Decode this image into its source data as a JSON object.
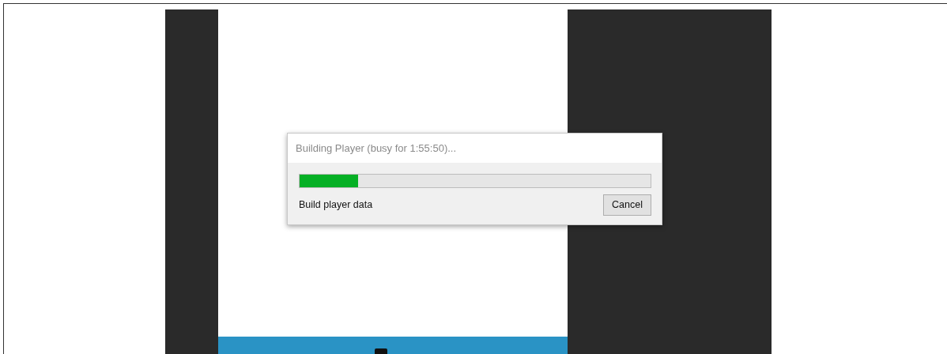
{
  "dialog": {
    "title": "Building Player (busy for 1:55:50)...",
    "progress": {
      "level": 0.166
    },
    "status": "Build player data",
    "buttons": [
      "Cancel"
    ]
  }
}
